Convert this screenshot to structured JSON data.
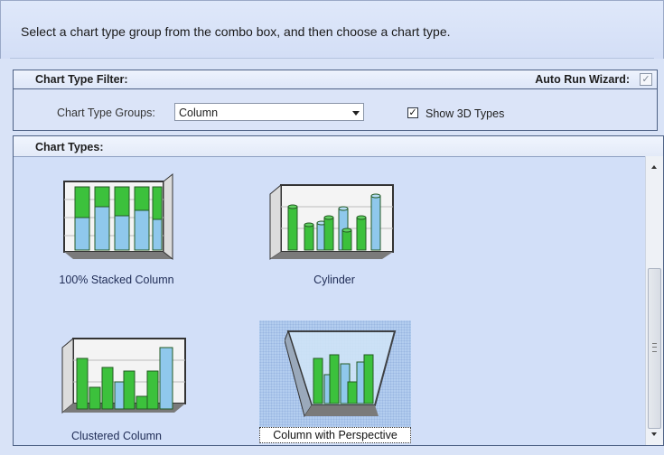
{
  "instructions": "Select a chart type group from the combo box, and then choose a chart type.",
  "filter": {
    "title": "Chart Type Filter:",
    "auto_run_label": "Auto Run Wizard:",
    "auto_run_checked": true,
    "groups_label": "Chart Type Groups:",
    "groups_value": "Column",
    "show3d_label": "Show 3D Types",
    "show3d_checked": true
  },
  "chart_types": {
    "title": "Chart Types:",
    "items": [
      {
        "label": "100% Stacked Column",
        "icon": "stacked-column-chart-icon"
      },
      {
        "label": "Cylinder",
        "icon": "cylinder-chart-icon"
      },
      {
        "label": "Clustered Column",
        "icon": "clustered-column-chart-icon"
      },
      {
        "label": "Column with Perspective",
        "icon": "perspective-column-chart-icon",
        "selected": true
      }
    ]
  },
  "colors": {
    "green": "#3cc13c",
    "blue": "#8fc8ec",
    "selection": "#b3cdef"
  }
}
